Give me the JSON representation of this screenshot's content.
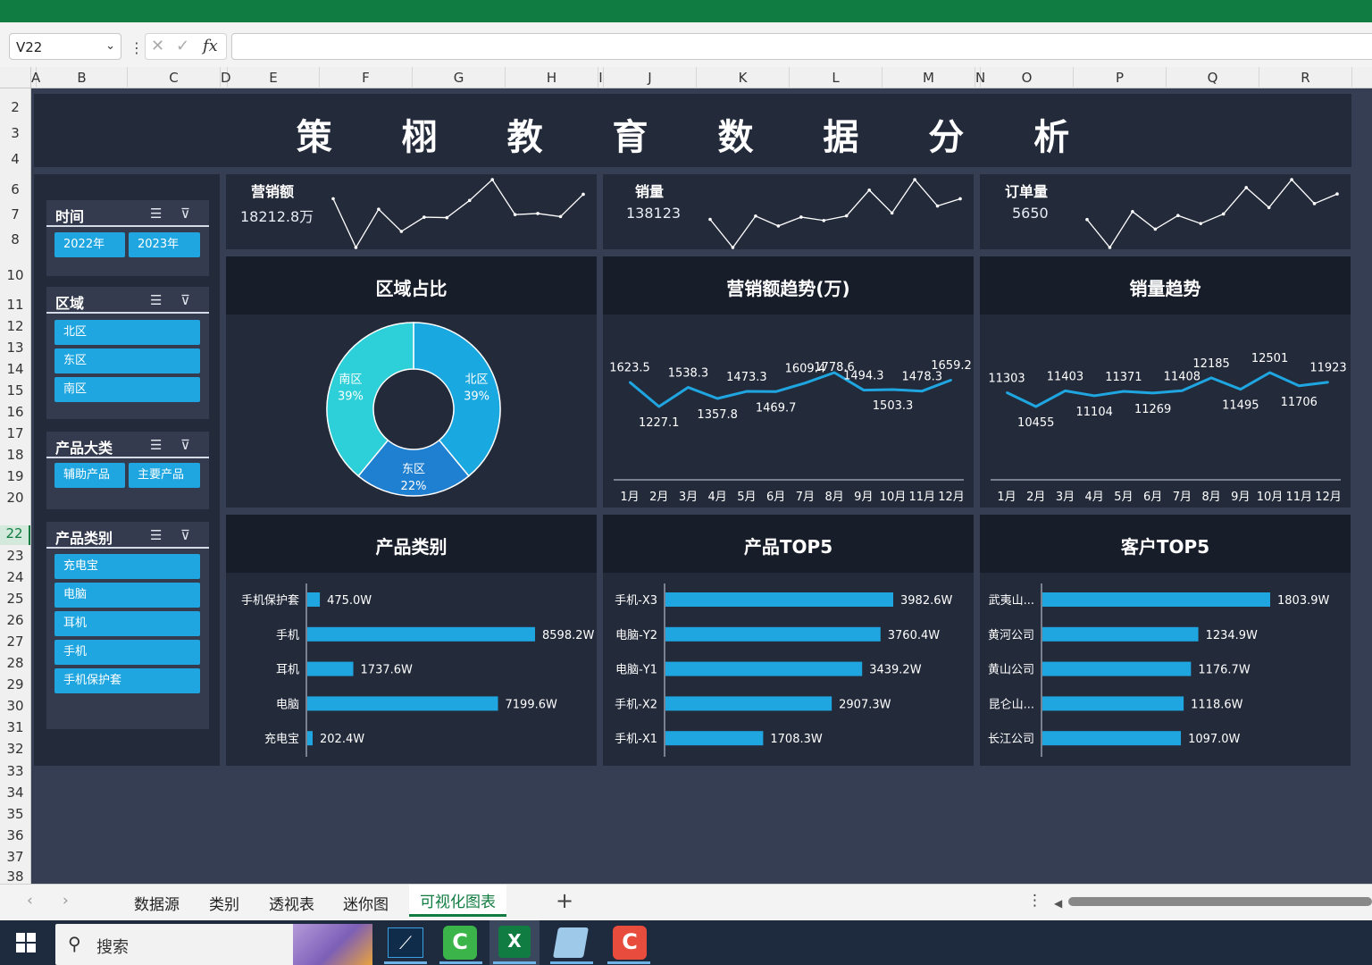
{
  "namebox": {
    "value": "V22"
  },
  "formula_bar": {
    "fx": "fx",
    "cancel": "✕",
    "enter": "✓",
    "value": ""
  },
  "columns": [
    "A",
    "B",
    "C",
    "D",
    "E",
    "F",
    "G",
    "H",
    "I",
    "J",
    "K",
    "L",
    "M",
    "N",
    "O",
    "P",
    "Q",
    "R"
  ],
  "rows": [
    "2",
    "3",
    "4",
    "6",
    "7",
    "8",
    "10",
    "11",
    "12",
    "13",
    "14",
    "15",
    "16",
    "17",
    "18",
    "19",
    "20",
    "22",
    "23",
    "24",
    "25",
    "26",
    "27",
    "28",
    "29",
    "30",
    "31",
    "32",
    "33",
    "34",
    "35",
    "36",
    "37",
    "38"
  ],
  "dashboard": {
    "title": "策 栩 教 育 数 据 分 析",
    "kpis": [
      {
        "label": "营销额",
        "value": "18212.8万",
        "spark": [
          1623.5,
          1227.1,
          1538.3,
          1357.8,
          1473.3,
          1469.7,
          1609.4,
          1778.6,
          1494.3,
          1503.3,
          1478.3,
          1659.2
        ]
      },
      {
        "label": "销量",
        "value": "138123",
        "spark": [
          11303,
          10455,
          11403,
          11104,
          11371,
          11269,
          11408,
          12185,
          11495,
          12501,
          11706,
          11923
        ]
      },
      {
        "label": "订单量",
        "value": "5650",
        "spark": [
          430,
          395,
          440,
          418,
          435,
          425,
          437,
          470,
          445,
          480,
          450,
          462
        ]
      }
    ],
    "slicers": [
      {
        "title": "时间",
        "items": [
          "2022年",
          "2023年"
        ]
      },
      {
        "title": "区域",
        "items": [
          "北区",
          "东区",
          "南区"
        ]
      },
      {
        "title": "产品大类",
        "items": [
          "辅助产品",
          "主要产品"
        ]
      },
      {
        "title": "产品类别",
        "items": [
          "充电宝",
          "电脑",
          "耳机",
          "手机",
          "手机保护套"
        ]
      }
    ],
    "panels": {
      "region": "区域占比",
      "sales_trend": "营销额趋势(万)",
      "volume_trend": "销量趋势",
      "category": "产品类别",
      "top_products": "产品TOP5",
      "top_customers": "客户TOP5"
    },
    "months": [
      "1月",
      "2月",
      "3月",
      "4月",
      "5月",
      "6月",
      "7月",
      "8月",
      "9月",
      "10月",
      "11月",
      "12月"
    ]
  },
  "sheet_tabs": [
    "数据源",
    "类别",
    "透视表",
    "迷你图",
    "可视化图表"
  ],
  "active_tab": "可视化图表",
  "taskbar": {
    "search": "搜索"
  },
  "colors": {
    "accent": "#1fa6e0",
    "panel": "#232a3a",
    "sheet_bg": "#363e54",
    "excel_green": "#107c41"
  },
  "chart_data": [
    {
      "type": "pie",
      "title": "区域占比",
      "categories": [
        "北区",
        "东区",
        "南区"
      ],
      "values": [
        39,
        22,
        39
      ],
      "labels": [
        "39%",
        "22%",
        "39%"
      ],
      "colors": [
        "#1aa8e0",
        "#1f7fd1",
        "#2dcfd8"
      ]
    },
    {
      "type": "line",
      "title": "营销额趋势(万)",
      "x": [
        "1月",
        "2月",
        "3月",
        "4月",
        "5月",
        "6月",
        "7月",
        "8月",
        "9月",
        "10月",
        "11月",
        "12月"
      ],
      "values": [
        1623.5,
        1227.1,
        1538.3,
        1357.8,
        1473.3,
        1469.7,
        1609.4,
        1778.6,
        1494.3,
        1503.3,
        1478.3,
        1659.2
      ]
    },
    {
      "type": "line",
      "title": "销量趋势",
      "x": [
        "1月",
        "2月",
        "3月",
        "4月",
        "5月",
        "6月",
        "7月",
        "8月",
        "9月",
        "10月",
        "11月",
        "12月"
      ],
      "values": [
        11303,
        10455,
        11403,
        11104,
        11371,
        11269,
        11408,
        12185,
        11495,
        12501,
        11706,
        11923
      ]
    },
    {
      "type": "bar",
      "orientation": "horizontal",
      "title": "产品类别",
      "categories": [
        "手机保护套",
        "手机",
        "耳机",
        "电脑",
        "充电宝"
      ],
      "values": [
        475.0,
        8598.2,
        1737.6,
        7199.6,
        202.4
      ],
      "labels": [
        "475.0W",
        "8598.2W",
        "1737.6W",
        "7199.6W",
        "202.4W"
      ]
    },
    {
      "type": "bar",
      "orientation": "horizontal",
      "title": "产品TOP5",
      "categories": [
        "手机-X3",
        "电脑-Y2",
        "电脑-Y1",
        "手机-X2",
        "手机-X1"
      ],
      "values": [
        3982.6,
        3760.4,
        3439.2,
        2907.3,
        1708.3
      ],
      "labels": [
        "3982.6W",
        "3760.4W",
        "3439.2W",
        "2907.3W",
        "1708.3W"
      ]
    },
    {
      "type": "bar",
      "orientation": "horizontal",
      "title": "客户TOP5",
      "categories": [
        "武夷山...",
        "黄河公司",
        "黄山公司",
        "昆仑山...",
        "长江公司"
      ],
      "values": [
        1803.9,
        1234.9,
        1176.7,
        1118.6,
        1097.0
      ],
      "labels": [
        "1803.9W",
        "1234.9W",
        "1176.7W",
        "1118.6W",
        "1097.0W"
      ]
    }
  ]
}
